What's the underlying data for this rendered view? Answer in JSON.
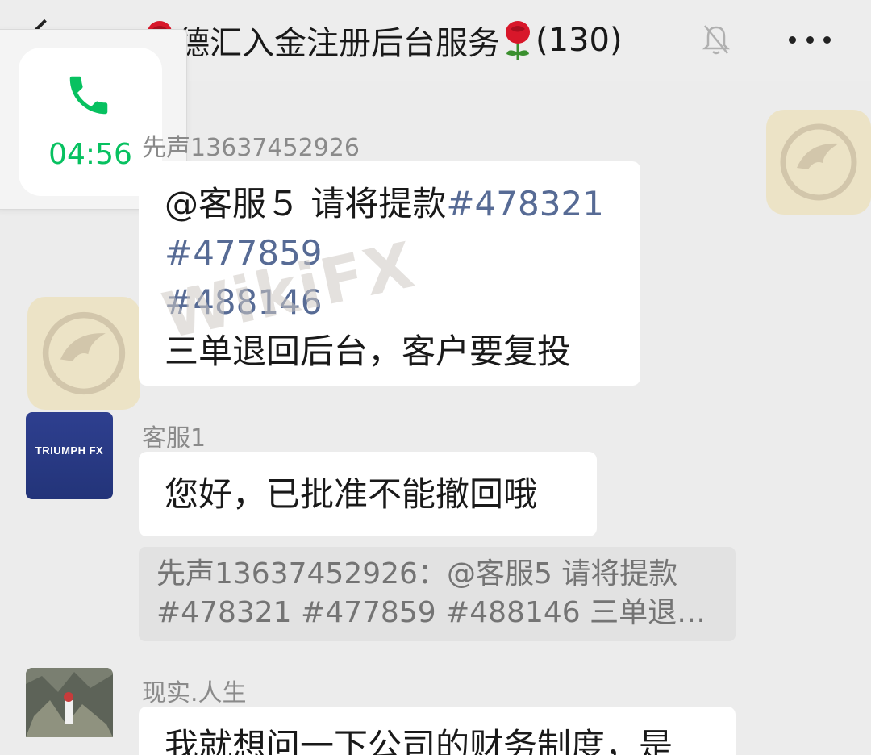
{
  "header": {
    "title": "德汇入金注册后台服务",
    "count": "(130)",
    "back_icon": "chevron-left-icon",
    "mute_icon": "bell-off-icon",
    "more_icon": "more-dots-icon"
  },
  "call": {
    "duration": "04:56",
    "icon": "phone-icon",
    "accent": "#07c160"
  },
  "messages": [
    {
      "sender": "先声13637452926",
      "lines": [
        {
          "prefix": "@客服５ 请将提款",
          "tag": "#478321"
        },
        {
          "prefix": "",
          "tag": "#477859"
        },
        {
          "prefix": "",
          "tag": "#488146"
        },
        {
          "prefix": "三单退回后台，客户要复投",
          "tag": ""
        }
      ]
    },
    {
      "sender": "客服1",
      "avatar_text": "TRIUMPH FX",
      "text": "您好，已批准不能撤回哦",
      "quote": [
        "先声13637452926：@客服5 请将提款",
        "#478321  #477859  #488146  三单退…"
      ]
    },
    {
      "sender": "现实.人生",
      "text": "我就想问一下公司的财务制度，是"
    }
  ],
  "watermark": {
    "text": "WikiFX"
  },
  "colors": {
    "background": "#ececec",
    "bubble": "#ffffff",
    "link": "#576b95",
    "quote_bg": "#e2e2e2"
  }
}
